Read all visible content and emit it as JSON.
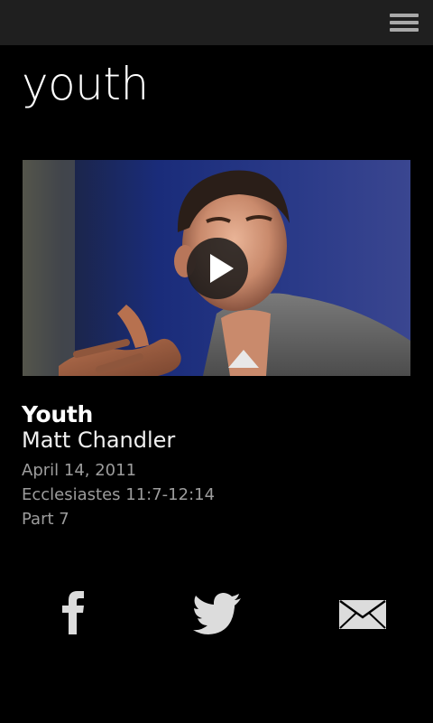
{
  "page": {
    "title": "youth"
  },
  "toolbar": {
    "menu_icon": "hamburger-menu-icon"
  },
  "video": {
    "play_icon": "play-icon"
  },
  "sermon": {
    "title": "Youth",
    "speaker": "Matt Chandler",
    "date": "April 14, 2011",
    "scripture": "Ecclesiastes 11:7-12:14",
    "part": "Part 7"
  },
  "share": {
    "facebook_icon": "facebook-icon",
    "twitter_icon": "twitter-icon",
    "email_icon": "email-icon"
  },
  "colors": {
    "background": "#000000",
    "topbar": "#1f1f1f",
    "text_primary": "#ffffff",
    "text_secondary": "#9d9d9d",
    "icon": "#d9d9d9"
  }
}
